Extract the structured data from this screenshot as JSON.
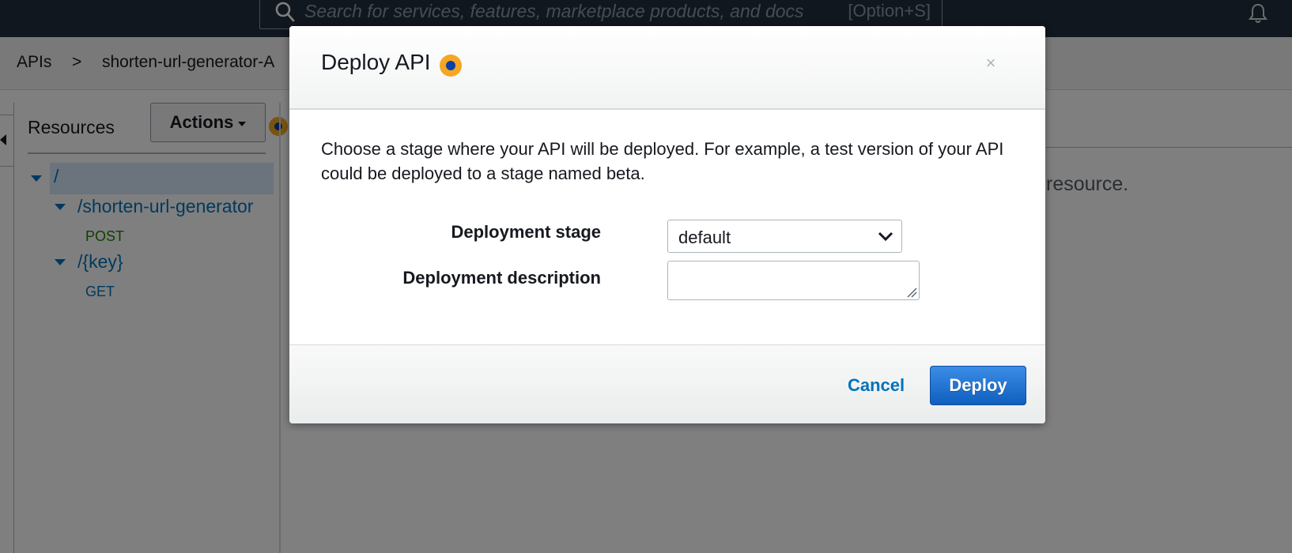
{
  "topnav": {
    "search_placeholder": "Search for services, features, marketplace products, and docs",
    "search_shortcut": "[Option+S]"
  },
  "breadcrumb": {
    "apis": "APIs",
    "separator": ">",
    "api_name": "shorten-url-generator-A"
  },
  "resources": {
    "title": "Resources",
    "actions_label": "Actions",
    "tree": {
      "root": "/",
      "child1": "/shorten-url-generator",
      "child1_method": "POST",
      "child2": "/{key}",
      "child2_method": "GET"
    }
  },
  "main": {
    "hint_fragment": "resource."
  },
  "modal": {
    "title": "Deploy API",
    "close_symbol": "×",
    "description": "Choose a stage where your API will be deployed. For example, a test version of your API could be deployed to a stage named beta.",
    "stage_label": "Deployment stage",
    "stage_value": "default",
    "description_label": "Deployment description",
    "description_value": "",
    "cancel_label": "Cancel",
    "deploy_label": "Deploy"
  },
  "colors": {
    "nav_bg": "#232f3e",
    "link_blue": "#0073bb",
    "post_green": "#1d8102",
    "deploy_blue": "#1b6fd6",
    "help_orange": "#f5a623"
  },
  "icons": [
    "search-icon",
    "bell-icon",
    "help-icon",
    "close-icon",
    "chevron-down-icon",
    "caret-down-icon",
    "resize-grip-icon"
  ]
}
